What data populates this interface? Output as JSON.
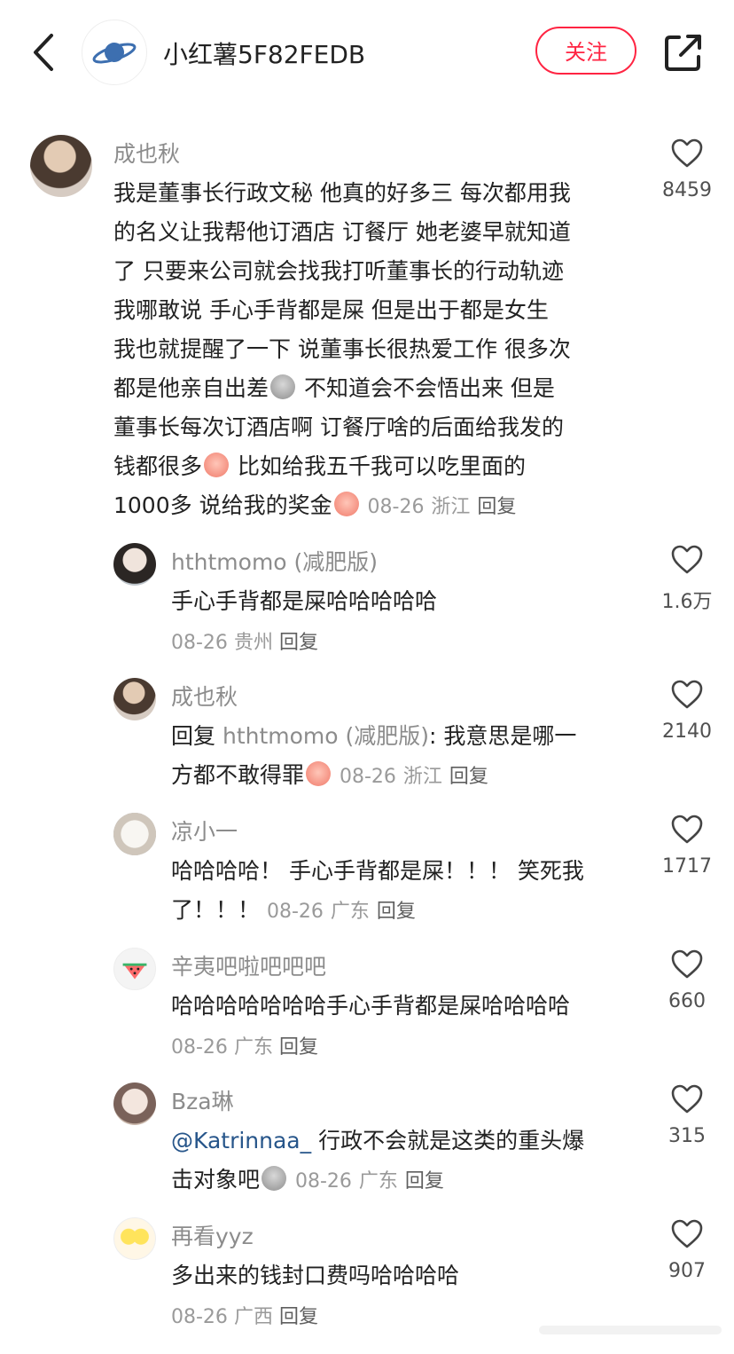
{
  "header": {
    "nickname": "小红薯5F82FEDB",
    "follow_label": "关注"
  },
  "main_comment": {
    "author": "成也秋",
    "lines": [
      "我是董事长行政文秘 他真的好多三 每次都用我",
      "的名义让我帮他订酒店 订餐厅 她老婆早就知道",
      "了 只要来公司就会找我打听董事长的行动轨迹",
      "我哪敢说 手心手背都是屎 但是出于都是女生",
      "我也就提醒了一下 说董事长很热爱工作 很多次",
      "都是他亲自出差",
      " 不知道会不会悟出来 但是",
      "董事长每次订酒店啊 订餐厅啥的后面给我发的",
      "钱都很多",
      " 比如给我五千我可以吃里面的",
      "1000多 说给我的奖金"
    ],
    "date": "08-26",
    "location": "浙江",
    "reply_label": "回复",
    "likes": "8459"
  },
  "replies": [
    {
      "author": "hthtmomo (减肥版)",
      "text": "手心手背都是屎哈哈哈哈哈",
      "date": "08-26",
      "location": "贵州",
      "reply_label": "回复",
      "likes": "1.6万"
    },
    {
      "author": "成也秋",
      "reply_prefix": "回复",
      "reply_to": "hthtmomo (减肥版)",
      "line1_tail": ": 我意思是哪一",
      "line2": "方都不敢得罪",
      "date": "08-26",
      "location": "浙江",
      "reply_label": "回复",
      "likes": "2140"
    },
    {
      "author": "凉小一",
      "line1": "哈哈哈哈！ 手心手背都是屎！！！ 笑死我",
      "line2": "了！！！",
      "date": "08-26",
      "location": "广东",
      "reply_label": "回复",
      "likes": "1717"
    },
    {
      "author": "辛夷吧啦吧吧吧",
      "text": "哈哈哈哈哈哈哈手心手背都是屎哈哈哈哈",
      "date": "08-26",
      "location": "广东",
      "reply_label": "回复",
      "likes": "660"
    },
    {
      "author": "Bza琳",
      "mention": "@Katrinnaa_",
      "line1_tail": " 行政不会就是这类的重头爆",
      "line2": "击对象吧",
      "date": "08-26",
      "location": "广东",
      "reply_label": "回复",
      "likes": "315"
    },
    {
      "author": "再看yyz",
      "text": "多出来的钱封口费吗哈哈哈哈",
      "date": "08-26",
      "location": "广西",
      "reply_label": "回复",
      "likes": "907"
    }
  ],
  "icons": [
    "back-chevron-icon",
    "planet-avatar-icon",
    "share-icon",
    "heart-icon",
    "sweat-emoji-icon",
    "crying-emoji-icon"
  ],
  "colors": {
    "accent": "#ff2442",
    "name_gray": "#8c8c8c",
    "mention_blue": "#26558a"
  }
}
